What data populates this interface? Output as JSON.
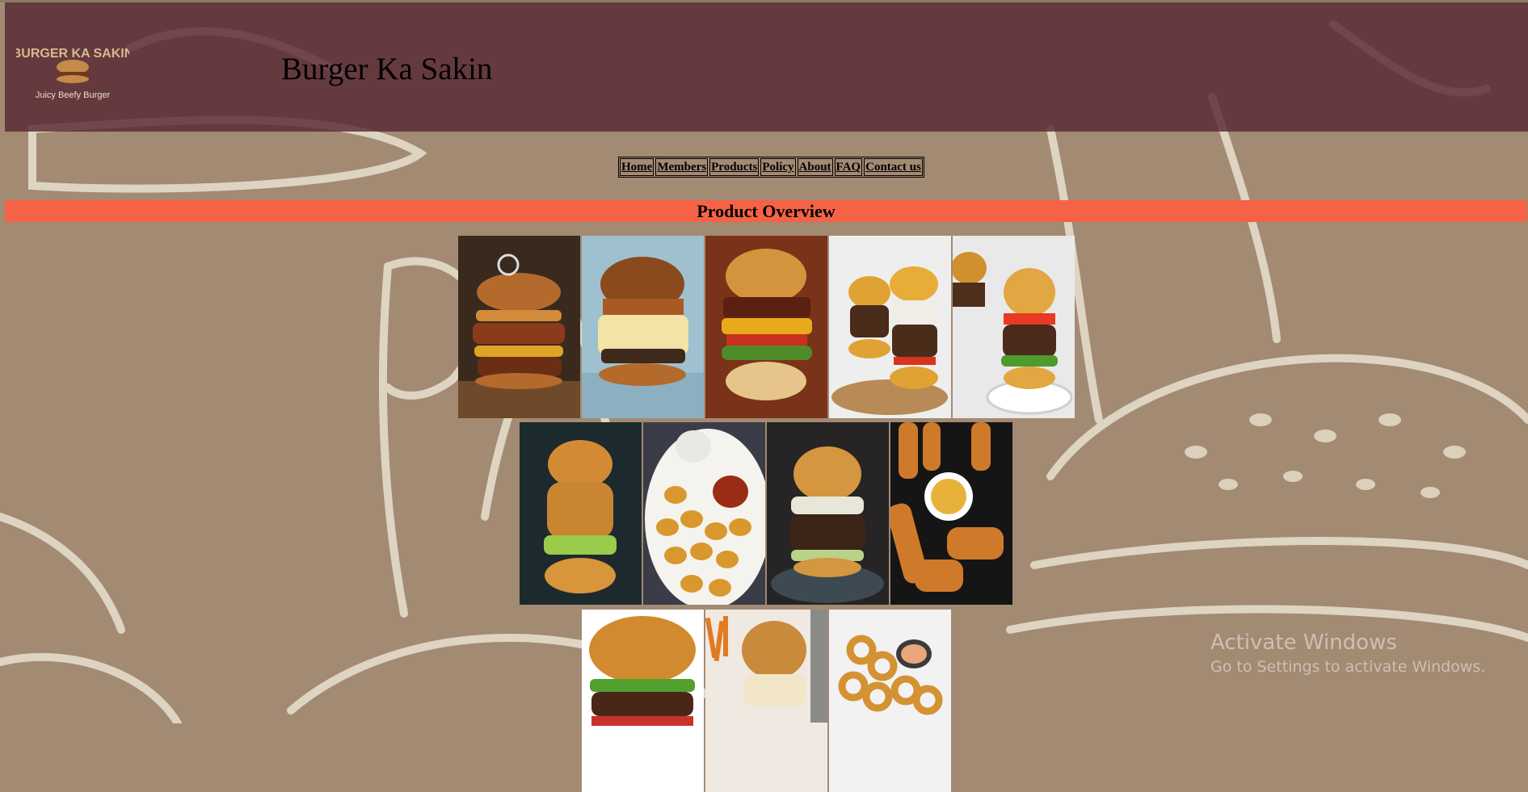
{
  "header": {
    "logo_text": "BURGER KA SAKIN",
    "logo_tagline": "Juicy Beefy Burger",
    "site_title": "Burger Ka Sakin"
  },
  "nav": {
    "items": [
      {
        "label": "Home"
      },
      {
        "label": "Members"
      },
      {
        "label": "Products"
      },
      {
        "label": "Policy"
      },
      {
        "label": "About"
      },
      {
        "label": "FAQ"
      },
      {
        "label": "Contact us"
      }
    ]
  },
  "section": {
    "title": "Product Overview"
  },
  "products": [
    {
      "icon": "onion-ring-burger-image"
    },
    {
      "icon": "cheese-burger-image"
    },
    {
      "icon": "bacon-cheese-burger-image"
    },
    {
      "icon": "slider-burgers-image"
    },
    {
      "icon": "mini-burgers-image"
    },
    {
      "icon": "crispy-chicken-burger-image"
    },
    {
      "icon": "chicken-nuggets-image"
    },
    {
      "icon": "slaw-burger-image"
    },
    {
      "icon": "fried-chicken-strips-image"
    },
    {
      "icon": "classic-burger-image"
    },
    {
      "icon": "burger-and-fries-image"
    },
    {
      "icon": "onion-rings-image"
    }
  ],
  "system": {
    "activation_title": "Activate Windows",
    "activation_subtitle": "Go to Settings to activate Windows."
  },
  "colors": {
    "header_bg": "#5a2832",
    "section_bar": "#f56245",
    "page_bg": "#a38a73"
  }
}
